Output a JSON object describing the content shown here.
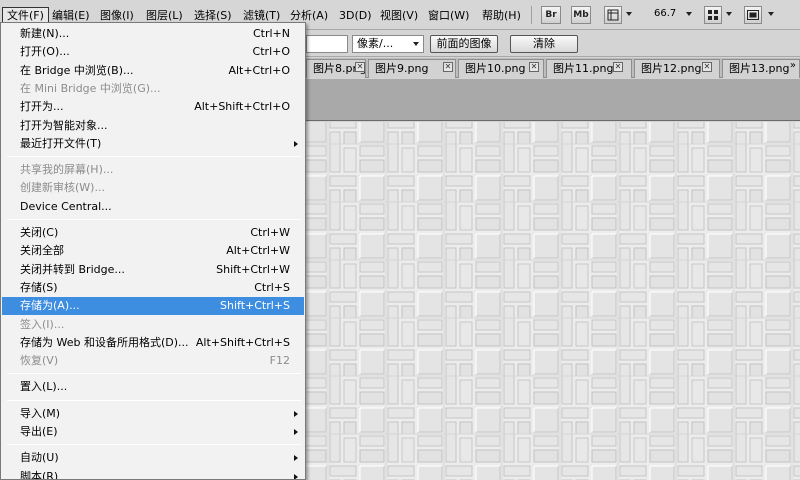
{
  "menubar": {
    "items": [
      {
        "label": "文件(F)",
        "active": true
      },
      {
        "label": "编辑(E)"
      },
      {
        "label": "图像(I)"
      },
      {
        "label": "图层(L)"
      },
      {
        "label": "选择(S)"
      },
      {
        "label": "滤镜(T)"
      },
      {
        "label": "分析(A)"
      },
      {
        "label": "3D(D)"
      },
      {
        "label": "视图(V)"
      },
      {
        "label": "窗口(W)"
      },
      {
        "label": "帮助(H)"
      }
    ],
    "bridge_button": "Br",
    "minibridge_button": "Mb",
    "zoom": "66.7"
  },
  "options": {
    "unit_select": "像素/...",
    "front_image_button": "前面的图像",
    "clear_button": "清除"
  },
  "tabs": [
    {
      "label": "图片8.png"
    },
    {
      "label": "图片9.png"
    },
    {
      "label": "图片10.png"
    },
    {
      "label": "图片11.png"
    },
    {
      "label": "图片12.png"
    },
    {
      "label": "图片13.png"
    }
  ],
  "tab_close_glyph": "✕",
  "tab_overflow_glyph": "»",
  "file_menu": [
    {
      "label": "新建(N)...",
      "shortcut": "Ctrl+N"
    },
    {
      "label": "打开(O)...",
      "shortcut": "Ctrl+O"
    },
    {
      "label": "在 Bridge 中浏览(B)...",
      "shortcut": "Alt+Ctrl+O"
    },
    {
      "label": "在 Mini Bridge 中浏览(G)...",
      "shortcut": "",
      "disabled": true
    },
    {
      "label": "打开为...",
      "shortcut": "Alt+Shift+Ctrl+O"
    },
    {
      "label": "打开为智能对象...",
      "shortcut": ""
    },
    {
      "label": "最近打开文件(T)",
      "shortcut": "",
      "submenu": true
    },
    {
      "separator": true
    },
    {
      "label": "共享我的屏幕(H)...",
      "shortcut": "",
      "disabled": true
    },
    {
      "label": "创建新审核(W)...",
      "shortcut": "",
      "disabled": true
    },
    {
      "label": "Device Central...",
      "shortcut": ""
    },
    {
      "separator": true
    },
    {
      "label": "关闭(C)",
      "shortcut": "Ctrl+W"
    },
    {
      "label": "关闭全部",
      "shortcut": "Alt+Ctrl+W"
    },
    {
      "label": "关闭并转到 Bridge...",
      "shortcut": "Shift+Ctrl+W"
    },
    {
      "label": "存储(S)",
      "shortcut": "Ctrl+S"
    },
    {
      "label": "存储为(A)...",
      "shortcut": "Shift+Ctrl+S",
      "highlight": true
    },
    {
      "label": "签入(I)...",
      "shortcut": "",
      "disabled": true
    },
    {
      "label": "存储为 Web 和设备所用格式(D)...",
      "shortcut": "Alt+Shift+Ctrl+S"
    },
    {
      "label": "恢复(V)",
      "shortcut": "F12",
      "disabled": true
    },
    {
      "separator": true
    },
    {
      "label": "置入(L)...",
      "shortcut": ""
    },
    {
      "separator": true
    },
    {
      "label": "导入(M)",
      "shortcut": "",
      "submenu": true
    },
    {
      "label": "导出(E)",
      "shortcut": "",
      "submenu": true
    },
    {
      "separator": true
    },
    {
      "label": "自动(U)",
      "shortcut": "",
      "submenu": true
    },
    {
      "label": "脚本(R)",
      "shortcut": "",
      "submenu": true
    }
  ],
  "colors": {
    "highlight": "#3d8ee0",
    "canvas": "#ececec"
  }
}
